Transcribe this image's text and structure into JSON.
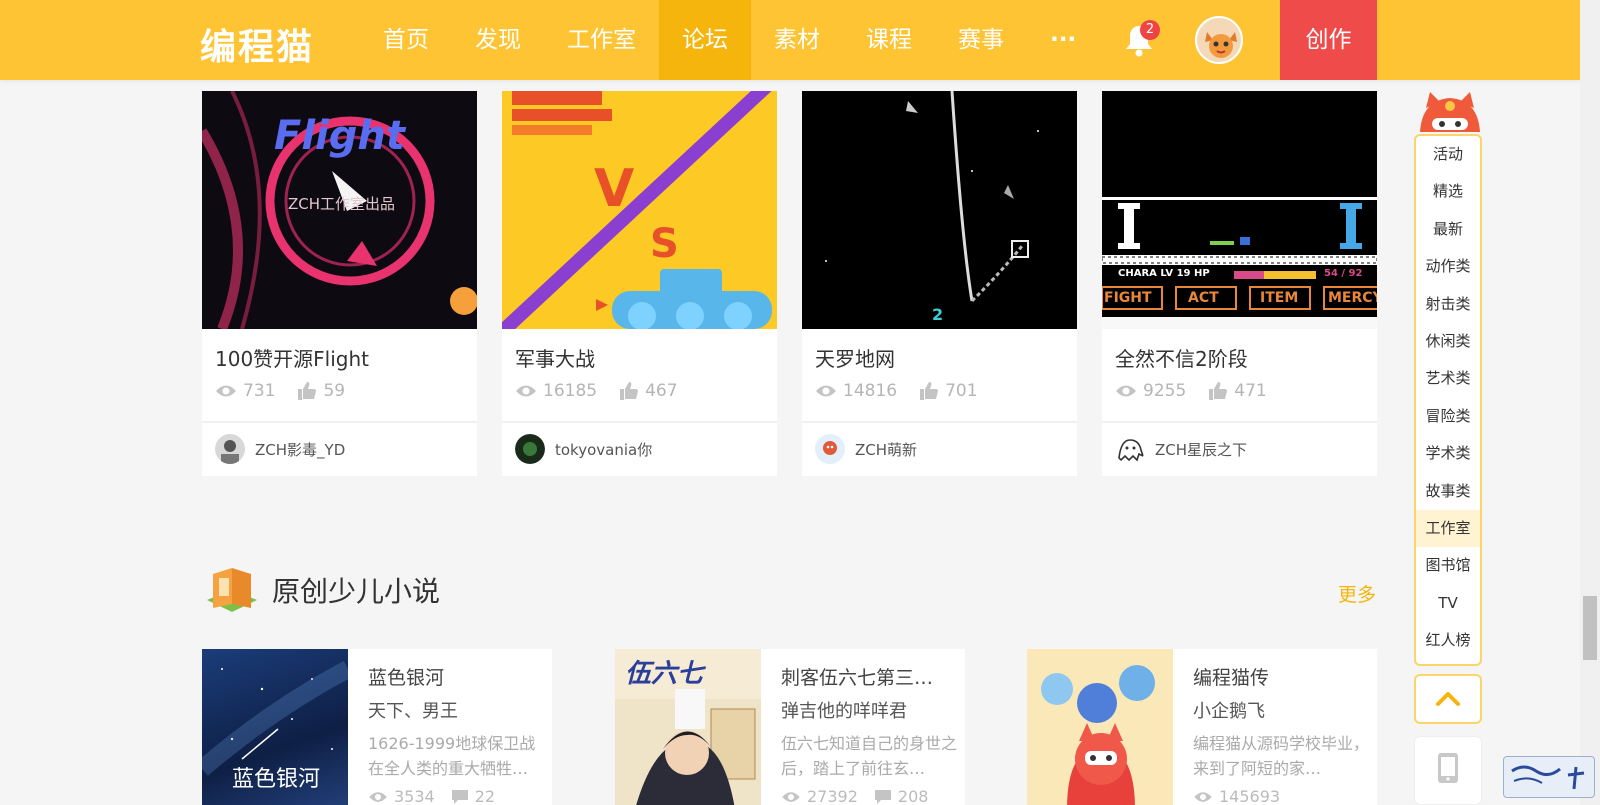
{
  "header": {
    "logo": "编程猫",
    "nav": [
      "首页",
      "发现",
      "工作室",
      "论坛",
      "素材",
      "课程",
      "赛事",
      "···"
    ],
    "active_nav_index": 3,
    "notification_count": "2",
    "create_label": "创作",
    "colors": {
      "bar": "#fec433",
      "active": "#f5b50c",
      "create": "#ef4b4b"
    }
  },
  "works": [
    {
      "title": "100赞开源Flight",
      "views": "731",
      "likes": "59",
      "author": "ZCH影毒_YD",
      "thumb_text": "Flight",
      "thumb_sub": "ZCH工作室出品"
    },
    {
      "title": "军事大战",
      "views": "16185",
      "likes": "467",
      "author": "tokyovania你",
      "thumb_text": "V",
      "thumb_sub": "S"
    },
    {
      "title": "天罗地网",
      "views": "14816",
      "likes": "701",
      "author": "ZCH萌新",
      "thumb_text": "2",
      "thumb_sub": ""
    },
    {
      "title": "全然不信2阶段",
      "views": "9255",
      "likes": "471",
      "author": "ZCH星辰之下",
      "thumb_text": "CHARA  LV 19  HP",
      "thumb_sub": "54 / 92",
      "buttons": [
        "FIGHT",
        "ACT",
        "ITEM",
        "MERCY"
      ]
    }
  ],
  "section": {
    "title": "原创少儿小说",
    "more": "更多"
  },
  "novels": [
    {
      "title": "蓝色银河",
      "author": "天下、男王",
      "desc": "1626-1999地球保卫战在全人类的重大牺牲…",
      "views": "3534",
      "comments": "22",
      "cover_text": "蓝色银河"
    },
    {
      "title": "刺客伍六七第三…",
      "author": "弹吉他的咩咩君",
      "desc": "伍六七知道自己的身世之后，踏上了前往玄…",
      "views": "27392",
      "comments": "208",
      "cover_text": "伍六七"
    },
    {
      "title": "编程猫传",
      "author": "小企鹅飞",
      "desc": "编程猫从源码学校毕业，来到了阿短的家…",
      "views": "145693",
      "comments": "",
      "cover_text": ""
    }
  ],
  "sidebar": {
    "items": [
      "活动",
      "精选",
      "最新",
      "动作类",
      "射击类",
      "休闲类",
      "艺术类",
      "冒险类",
      "学术类",
      "故事类",
      "工作室",
      "图书馆",
      "TV",
      "红人榜"
    ],
    "active_index": 10
  },
  "icons": {
    "views": "eye-icon",
    "likes": "thumb-up-icon",
    "comments": "comment-icon",
    "bell": "bell-icon",
    "top": "chevron-up-icon",
    "phone": "phone-icon"
  }
}
